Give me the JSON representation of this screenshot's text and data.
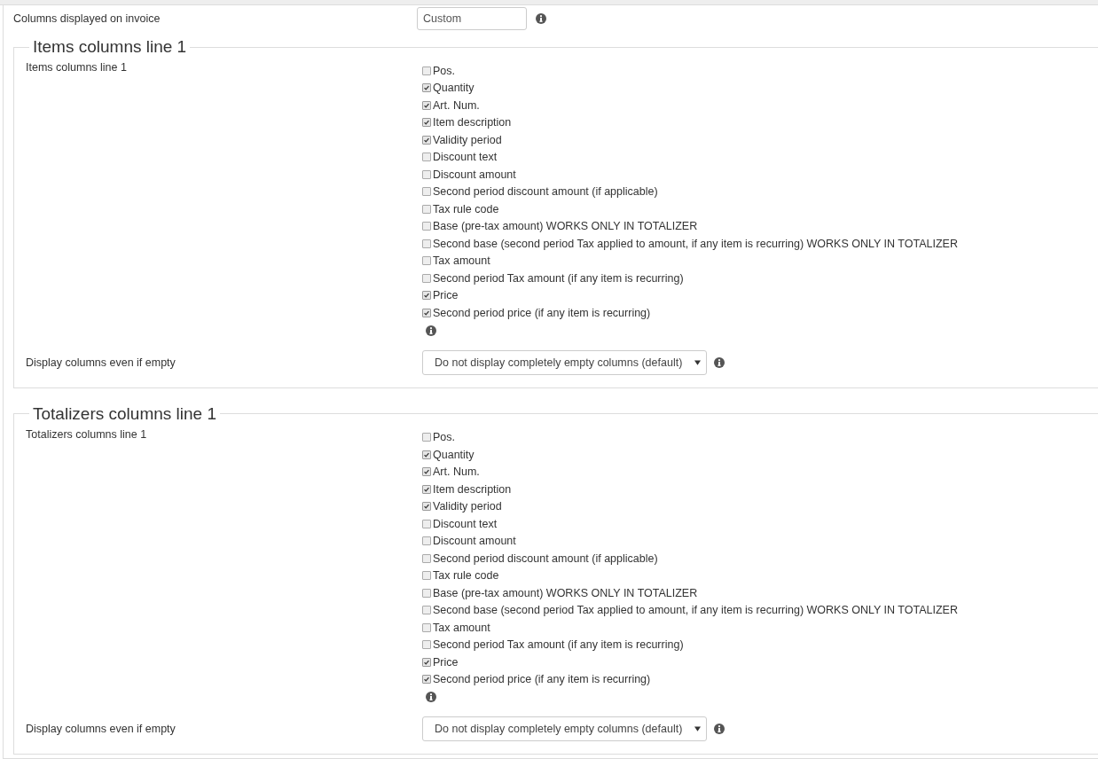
{
  "top_setting": {
    "label": "Columns displayed on invoice",
    "value": "Custom"
  },
  "sections": [
    {
      "legend": "Items columns line 1",
      "label": "Items columns line 1",
      "options": [
        {
          "label": "Pos.",
          "checked": false
        },
        {
          "label": "Quantity",
          "checked": true
        },
        {
          "label": "Art. Num.",
          "checked": true
        },
        {
          "label": "Item description",
          "checked": true
        },
        {
          "label": "Validity period",
          "checked": true
        },
        {
          "label": "Discount text",
          "checked": false
        },
        {
          "label": "Discount amount",
          "checked": false
        },
        {
          "label": "Second period discount amount (if applicable)",
          "checked": false
        },
        {
          "label": "Tax rule code",
          "checked": false
        },
        {
          "label": "Base (pre-tax amount) WORKS ONLY IN TOTALIZER",
          "checked": false
        },
        {
          "label": "Second base (second period Tax applied to amount, if any item is recurring) WORKS ONLY IN TOTALIZER",
          "checked": false
        },
        {
          "label": "Tax amount",
          "checked": false
        },
        {
          "label": "Second period Tax amount (if any item is recurring)",
          "checked": false
        },
        {
          "label": "Price",
          "checked": true
        },
        {
          "label": "Second period price (if any item is recurring)",
          "checked": true
        }
      ],
      "empty_setting": {
        "label": "Display columns even if empty",
        "value": "Do not display completely empty columns (default)"
      }
    },
    {
      "legend": "Totalizers columns line 1",
      "label": "Totalizers columns line 1",
      "options": [
        {
          "label": "Pos.",
          "checked": false
        },
        {
          "label": "Quantity",
          "checked": true
        },
        {
          "label": "Art. Num.",
          "checked": true
        },
        {
          "label": "Item description",
          "checked": true
        },
        {
          "label": "Validity period",
          "checked": true
        },
        {
          "label": "Discount text",
          "checked": false
        },
        {
          "label": "Discount amount",
          "checked": false
        },
        {
          "label": "Second period discount amount (if applicable)",
          "checked": false
        },
        {
          "label": "Tax rule code",
          "checked": false
        },
        {
          "label": "Base (pre-tax amount) WORKS ONLY IN TOTALIZER",
          "checked": false
        },
        {
          "label": "Second base (second period Tax applied to amount, if any item is recurring) WORKS ONLY IN TOTALIZER",
          "checked": false
        },
        {
          "label": "Tax amount",
          "checked": false
        },
        {
          "label": "Second period Tax amount (if any item is recurring)",
          "checked": false
        },
        {
          "label": "Price",
          "checked": true
        },
        {
          "label": "Second period price (if any item is recurring)",
          "checked": true
        }
      ],
      "empty_setting": {
        "label": "Display columns even if empty",
        "value": "Do not display completely empty columns (default)"
      }
    }
  ]
}
